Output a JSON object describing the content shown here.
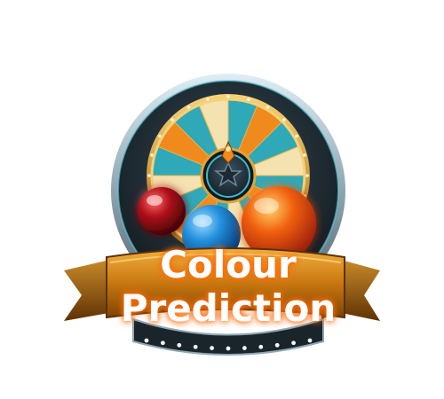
{
  "logo": {
    "title_line1": "Colour",
    "title_line2": "Prediction"
  },
  "colors": {
    "ring_dark": "#1f2b33",
    "ring_rim": "#9fb6c2",
    "wheel_teal": "#2fa9b8",
    "wheel_orange": "#f08a1c",
    "ball_red": "#a50d12",
    "ball_blue": "#1f8bd6",
    "ball_orange": "#f25a0c",
    "ribbon_gold": "#c9780f",
    "text_glow": "#ff7a00"
  },
  "icons": {
    "hub": "star-hub-icon",
    "pointer": "wheel-pointer-icon"
  }
}
